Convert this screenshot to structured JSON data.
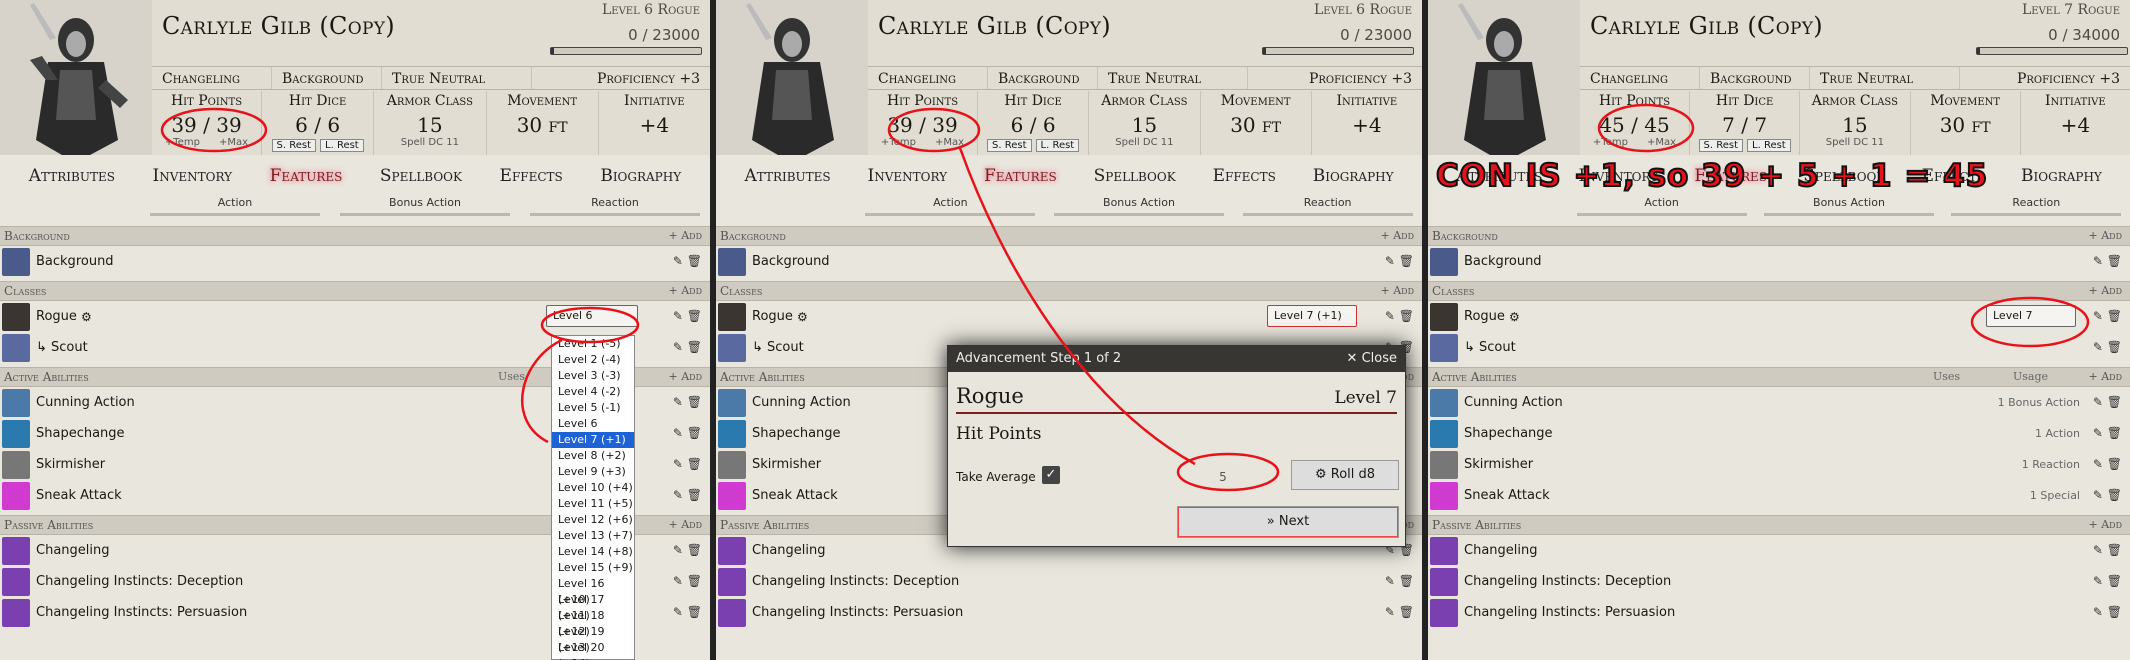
{
  "panel1": {
    "name": "Carlyle Gilb (Copy)",
    "level_label": "Level 6 Rogue",
    "xp": "0 / 23000",
    "xp_progress": 0,
    "details": [
      "Changeling",
      "Background",
      "True Neutral",
      "Proficiency +3"
    ],
    "hit_points": {
      "label": "Hit Points",
      "value": "39",
      "sep": "/",
      "max": "39",
      "temp": "+Temp",
      "maxlbl": "+Max"
    },
    "hit_dice": {
      "label": "Hit Dice",
      "value": "6 / 6",
      "srest": "S. Rest",
      "lrest": "L. Rest"
    },
    "armor_class": {
      "label": "Armor Class",
      "value": "15",
      "sub": "Spell DC 11"
    },
    "movement": {
      "label": "Movement",
      "value": "30 ft"
    },
    "initiative": {
      "label": "Initiative",
      "value": "+4"
    },
    "tabs": [
      "Attributes",
      "Inventory",
      "Features",
      "Spellbook",
      "Effects",
      "Biography"
    ],
    "subtabs": [
      "Action",
      "Bonus Action",
      "Reaction"
    ],
    "sections": {
      "background": "Background",
      "classes": "Classes",
      "active": "Active Abilities",
      "passive": "Passive Abilities",
      "add": "+ Add",
      "uses": "Uses"
    },
    "rows": {
      "background": "Background",
      "rogue": "Rogue",
      "scout": "↳ Scout",
      "cunning": "Cunning Action",
      "shapechange": "Shapechange",
      "skirmisher": "Skirmisher",
      "sneak": "Sneak Attack",
      "changeling": "Changeling",
      "deception": "Changeling Instincts: Deception",
      "persuasion": "Changeling Instincts: Persuasion"
    },
    "level_select": "Level 6",
    "dropdown": [
      "Level 1 (-5)",
      "Level 2 (-4)",
      "Level 3 (-3)",
      "Level 4 (-2)",
      "Level 5 (-1)",
      "Level 6",
      "Level 7 (+1)",
      "Level 8 (+2)",
      "Level 9 (+3)",
      "Level 10 (+4)",
      "Level 11 (+5)",
      "Level 12 (+6)",
      "Level 13 (+7)",
      "Level 14 (+8)",
      "Level 15 (+9)",
      "Level 16 (+10)",
      "Level 17 (+11)",
      "Level 18 (+12)",
      "Level 19 (+13)",
      "Level 20 (+14)"
    ]
  },
  "panel2": {
    "name": "Carlyle Gilb (Copy)",
    "level_label": "Level 6 Rogue",
    "xp": "0 / 23000",
    "details": [
      "Changeling",
      "Background",
      "True Neutral",
      "Proficiency +3"
    ],
    "hit_points": {
      "label": "Hit Points",
      "value": "39",
      "sep": "/",
      "max": "39",
      "temp": "+Temp",
      "maxlbl": "+Max"
    },
    "hit_dice": {
      "label": "Hit Dice",
      "value": "6 / 6",
      "srest": "S. Rest",
      "lrest": "L. Rest"
    },
    "armor_class": {
      "label": "Armor Class",
      "value": "15",
      "sub": "Spell DC 11"
    },
    "movement": {
      "label": "Movement",
      "value": "30 ft"
    },
    "initiative": {
      "label": "Initiative",
      "value": "+4"
    },
    "level_select": "Level 7 (+1)"
  },
  "dialog": {
    "title": "Advancement Step 1 of 2",
    "close": "Close",
    "class": "Rogue",
    "level": "Level 7",
    "section": "Hit Points",
    "take_average": "Take Average",
    "value": "5",
    "roll": "Roll d8",
    "next": "Next"
  },
  "panel3": {
    "name": "Carlyle Gilb (Copy)",
    "level_label": "Level 7 Rogue",
    "xp": "0 / 34000",
    "details": [
      "Changeling",
      "Background",
      "True Neutral",
      "Proficiency +3"
    ],
    "hit_points": {
      "label": "Hit Points",
      "value": "45",
      "sep": "/",
      "max": "45",
      "temp": "+Temp",
      "maxlbl": "+Max"
    },
    "hit_dice": {
      "label": "Hit Dice",
      "value": "7 / 7",
      "srest": "S. Rest",
      "lrest": "L. Rest"
    },
    "armor_class": {
      "label": "Armor Class",
      "value": "15",
      "sub": "Spell DC 11"
    },
    "movement": {
      "label": "Movement",
      "value": "30 ft"
    },
    "initiative": {
      "label": "Initiative",
      "value": "+4"
    },
    "level_select": "Level 7",
    "usage_col": "Usage",
    "usages": [
      "1 Bonus Action",
      "1 Action",
      "1 Reaction",
      "1 Special"
    ],
    "annotation": "CON IS +1, so 39 + 5 + 1 = 45"
  },
  "colors": {
    "accent": "#7a1e1e",
    "highlight": "#1e63d6",
    "annotation": "#e8131a"
  }
}
